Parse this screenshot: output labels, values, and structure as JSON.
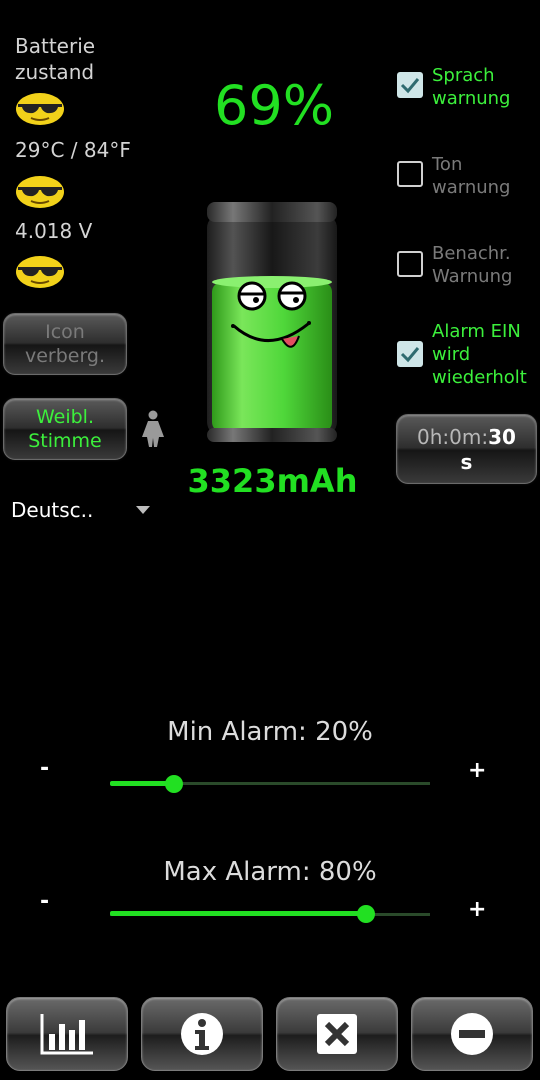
{
  "left": {
    "battery_state": "Batterie\nzustand",
    "temperature": "29°C / 84°F",
    "voltage": "4.018 V",
    "hide_icon_label": "Icon\nverberg.",
    "voice_label": "Weibl.\nStimme",
    "language": "Deutsc.."
  },
  "center": {
    "percent": "69%",
    "capacity": "3323mAh",
    "level": 0.69
  },
  "right": {
    "options": [
      {
        "label": "Sprach\nwarnung",
        "checked": true
      },
      {
        "label": "Ton\nwarnung",
        "checked": false
      },
      {
        "label": "Benachr.\nWarnung",
        "checked": false
      },
      {
        "label": "Alarm EIN\nwird\nwiederholt",
        "checked": true
      }
    ],
    "timer_prefix": "0h:0m:",
    "timer_value": "30",
    "timer_unit": "s"
  },
  "sliders": {
    "min_title": "Min Alarm: 20%",
    "min_value": 20,
    "max_title": "Max Alarm: 80%",
    "max_value": 80,
    "minus": "-",
    "plus": "+"
  },
  "colors": {
    "accent": "#22e022",
    "label_green": "#3cf03c",
    "label_gray": "#7a7a7a"
  },
  "bottom": {
    "buttons": [
      "chart-icon",
      "info-icon",
      "close-icon",
      "minus-circle-icon"
    ]
  }
}
